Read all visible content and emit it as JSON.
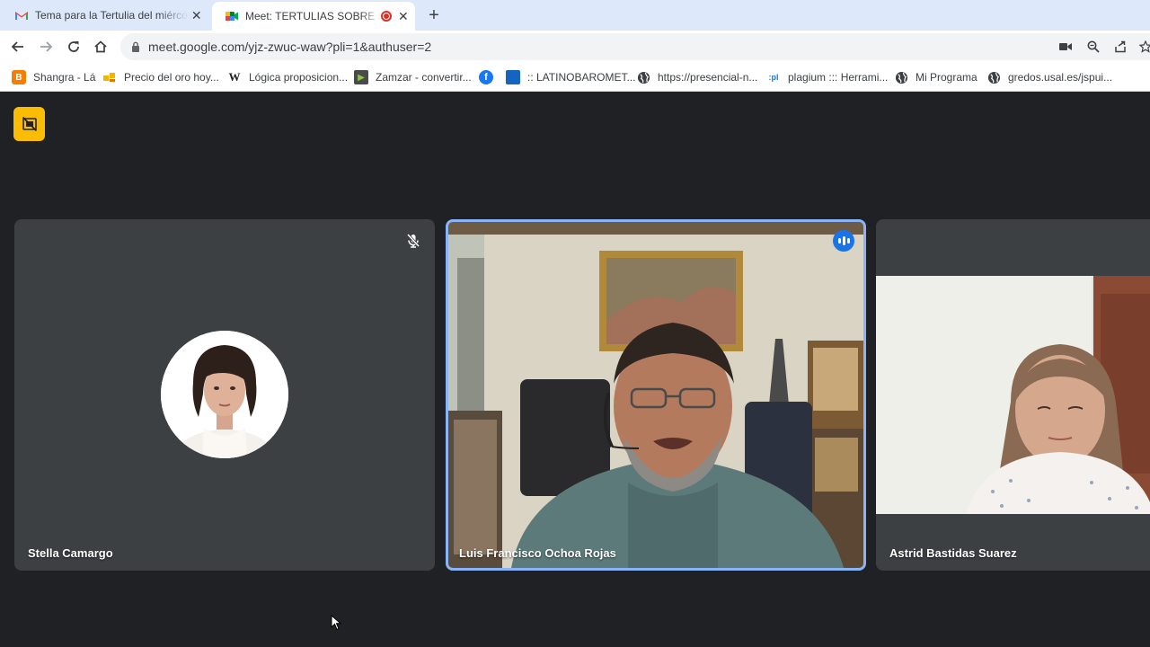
{
  "browser": {
    "tabs": [
      {
        "title": "Tema para la Tertulia del miércoles",
        "favicon": "gmail-icon",
        "active": false
      },
      {
        "title": "Meet: TERTULIAS SOBRE FILOSOFÍA",
        "favicon": "google-meet-icon",
        "active": true,
        "recording": true
      }
    ],
    "url": "meet.google.com/yjz-zwuc-waw?pli=1&authuser=2",
    "bookmarks": [
      {
        "label": "Shangra - Lá",
        "icon": "blogger-icon"
      },
      {
        "label": "Precio del oro hoy...",
        "icon": "chart-icon"
      },
      {
        "label": "Lógica proposicion...",
        "icon": "wikipedia-icon"
      },
      {
        "label": "Zamzar - convertir...",
        "icon": "zamzar-icon"
      },
      {
        "label": "",
        "icon": "facebook-icon"
      },
      {
        "label": ":: LATINOBAROMET...",
        "icon": "latinobarometro-icon"
      },
      {
        "label": "https://presencial-n...",
        "icon": "globe-icon"
      },
      {
        "label": "plagium ::: Herrami...",
        "icon": "plagium-icon"
      },
      {
        "label": "Mi Programa",
        "icon": "globe-icon"
      },
      {
        "label": "gredos.usal.es/jspui...",
        "icon": "globe-icon"
      }
    ]
  },
  "meet": {
    "participants": [
      {
        "name": "Stella Camargo",
        "muted": true,
        "speaking": false,
        "video": false
      },
      {
        "name": "Luis Francisco Ochoa Rojas",
        "muted": false,
        "speaking": true,
        "video": true
      },
      {
        "name": "Astrid Bastidas Suarez",
        "muted": false,
        "speaking": false,
        "video": true
      }
    ]
  },
  "colors": {
    "tabstrip": "#dee8fb",
    "meet_background": "#202124",
    "tile_background": "#3c4043",
    "active_speaker_border": "#8ab4f8",
    "speaking_badge": "#1a73e8",
    "no_frame_button": "#fbbc04"
  }
}
